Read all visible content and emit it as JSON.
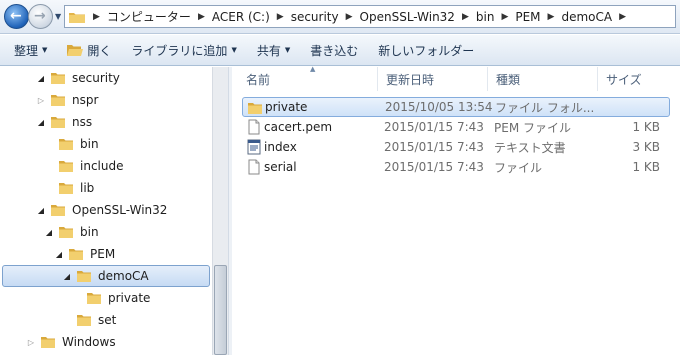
{
  "address_bar": {
    "breadcrumbs": [
      "コンピューター",
      "ACER (C:)",
      "security",
      "OpenSSL-Win32",
      "bin",
      "PEM",
      "demoCA"
    ]
  },
  "command_bar": {
    "organize": "整理",
    "open": "開く",
    "include_in_library": "ライブラリに追加",
    "share": "共有",
    "burn": "書き込む",
    "new_folder": "新しいフォルダー"
  },
  "tree": {
    "items": [
      {
        "label": "security",
        "icon": "folder-icon",
        "expanded": true
      },
      {
        "label": "nspr",
        "icon": "folder-icon",
        "expanded": false
      },
      {
        "label": "nss",
        "icon": "folder-icon",
        "expanded": true
      },
      {
        "label": "bin",
        "icon": "folder-icon"
      },
      {
        "label": "include",
        "icon": "folder-icon"
      },
      {
        "label": "lib",
        "icon": "folder-icon"
      },
      {
        "label": "OpenSSL-Win32",
        "icon": "folder-icon",
        "expanded": true
      },
      {
        "label": "bin",
        "icon": "folder-icon",
        "expanded": true
      },
      {
        "label": "PEM",
        "icon": "folder-icon",
        "expanded": true
      },
      {
        "label": "demoCA",
        "icon": "folder-icon",
        "expanded": true,
        "selected": true
      },
      {
        "label": "private",
        "icon": "folder-icon"
      },
      {
        "label": "set",
        "icon": "folder-icon"
      },
      {
        "label": "Windows",
        "icon": "folder-icon",
        "expanded": false
      }
    ]
  },
  "file_list": {
    "columns": {
      "name": "名前",
      "date": "更新日時",
      "type": "種類",
      "size": "サイズ"
    },
    "rows": [
      {
        "name": "private",
        "date": "2015/10/05 13:54",
        "type": "ファイル フォル...",
        "size": "",
        "icon": "folder-icon",
        "selected": true
      },
      {
        "name": "cacert.pem",
        "date": "2015/01/15 7:43",
        "type": "PEM ファイル",
        "size": "1 KB",
        "icon": "file-icon"
      },
      {
        "name": "index",
        "date": "2015/01/15 7:43",
        "type": "テキスト文書",
        "size": "3 KB",
        "icon": "text-document-icon"
      },
      {
        "name": "serial",
        "date": "2015/01/15 7:43",
        "type": "ファイル",
        "size": "1 KB",
        "icon": "file-icon"
      }
    ]
  },
  "colors": {
    "selection_fill": "#cfe2f8",
    "selection_border": "#84acdd",
    "folder": "#e8c15a"
  }
}
